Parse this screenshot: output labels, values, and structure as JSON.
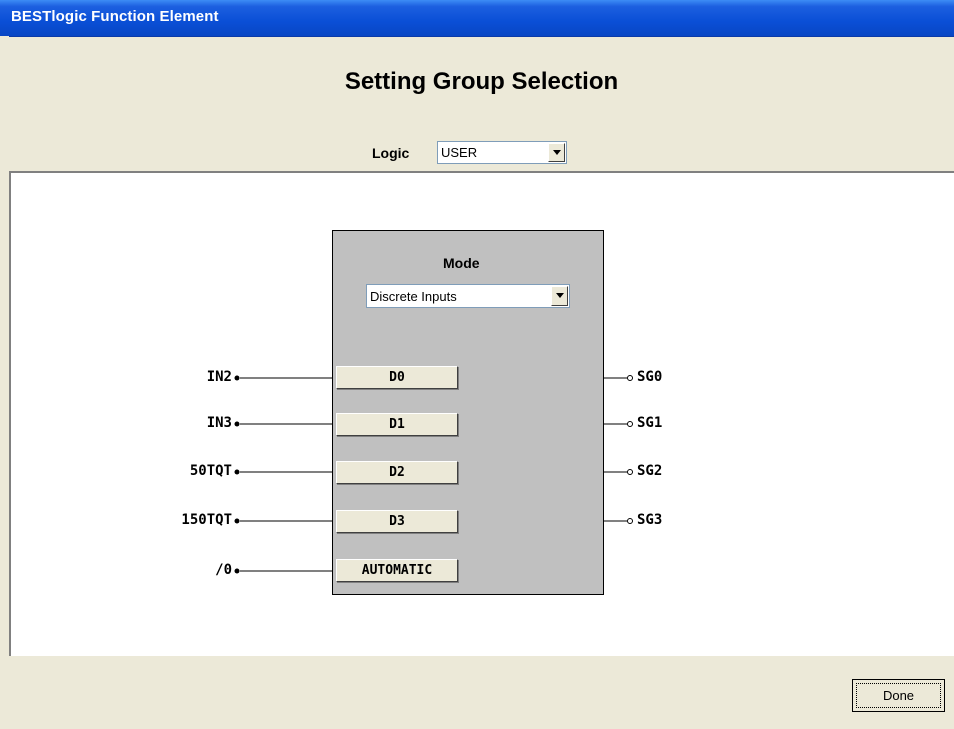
{
  "window": {
    "title": "BESTlogic Function Element"
  },
  "header": {
    "heading": "Setting Group Selection",
    "logic_label": "Logic",
    "logic_value": "USER"
  },
  "block": {
    "mode_label": "Mode",
    "mode_value": "Discrete Inputs",
    "input_buttons": [
      "D0",
      "D1",
      "D2",
      "D3",
      "AUTOMATIC"
    ],
    "input_signals": [
      "IN2",
      "IN3",
      "50TQT",
      "150TQT",
      "/0"
    ],
    "output_signals": [
      "SG0",
      "SG1",
      "SG2",
      "SG3"
    ]
  },
  "footer": {
    "done_label": "Done"
  }
}
